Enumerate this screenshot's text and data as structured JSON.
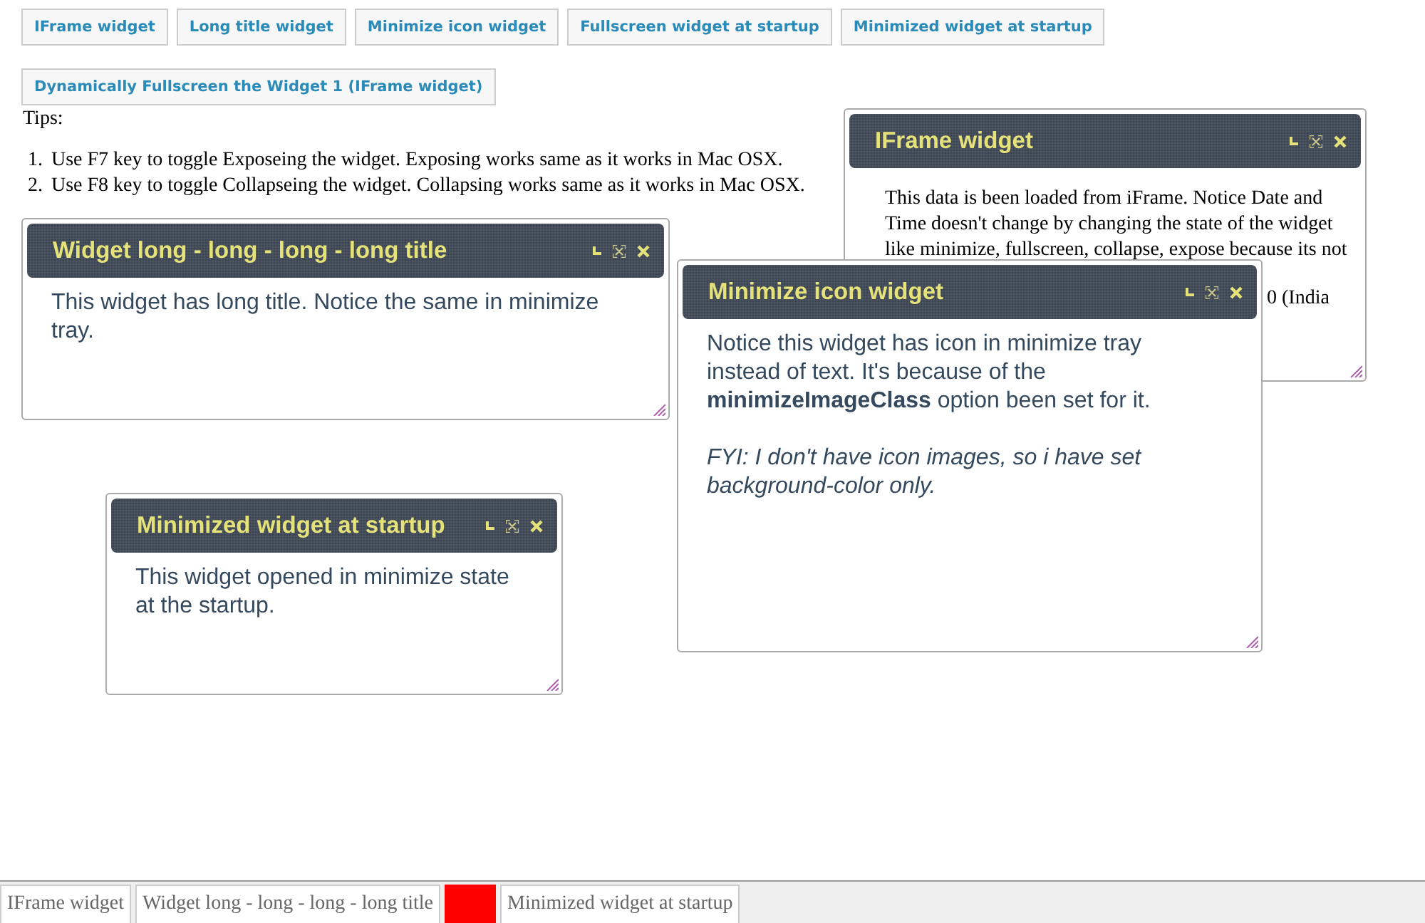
{
  "buttons": [
    {
      "label": "IFrame widget"
    },
    {
      "label": "Long title widget"
    },
    {
      "label": "Minimize icon widget"
    },
    {
      "label": "Fullscreen widget at startup"
    },
    {
      "label": "Minimized widget at startup"
    }
  ],
  "action_button": {
    "label": "Dynamically Fullscreen the Widget 1 (IFrame widget)"
  },
  "tips": {
    "heading": "Tips:",
    "items": [
      {
        "number": "1.",
        "text": "Use F7 key to toggle Exposeing the widget. Exposing works same as it works in Mac OSX."
      },
      {
        "number": "2.",
        "text": "Use F8 key to toggle Collapseing the widget. Collapsing works same as it works in Mac OSX."
      }
    ]
  },
  "widgets": [
    {
      "title": "IFrame widget",
      "kind": "iframe",
      "lines": [
        "This data is been loaded from iFrame. Notice Date and",
        "Time doesn't change by changing the state of the widget",
        "like minimize, fullscreen, collapse, expose because its not",
        "0 (India"
      ]
    },
    {
      "title": "Widget long - long - long - long title",
      "kind": "text",
      "paragraphs": [
        {
          "kind": "body",
          "text": "This widget has long title. Notice the same in minimize tray."
        }
      ]
    },
    {
      "title": "Minimized widget at startup",
      "kind": "text",
      "paragraphs": [
        {
          "kind": "body",
          "text": "This widget opened in minimize state at the startup."
        }
      ]
    },
    {
      "title": "Minimize icon widget",
      "kind": "text",
      "paragraphs": [
        {
          "kind": "body",
          "text": "Notice this widget has icon in minimize tray instead of text. It's because of the **minimizeImageClass** option been set for it."
        },
        {
          "kind": "note",
          "text": "FYI: I don't have icon images, so i have set background-color only."
        }
      ]
    }
  ],
  "tray": [
    {
      "kind": "label",
      "label": "IFrame widget"
    },
    {
      "kind": "label",
      "label": "Widget long - long - long - long title"
    },
    {
      "kind": "icon",
      "color": "#ff0000"
    },
    {
      "kind": "label",
      "label": "Minimized widget at startup"
    }
  ]
}
